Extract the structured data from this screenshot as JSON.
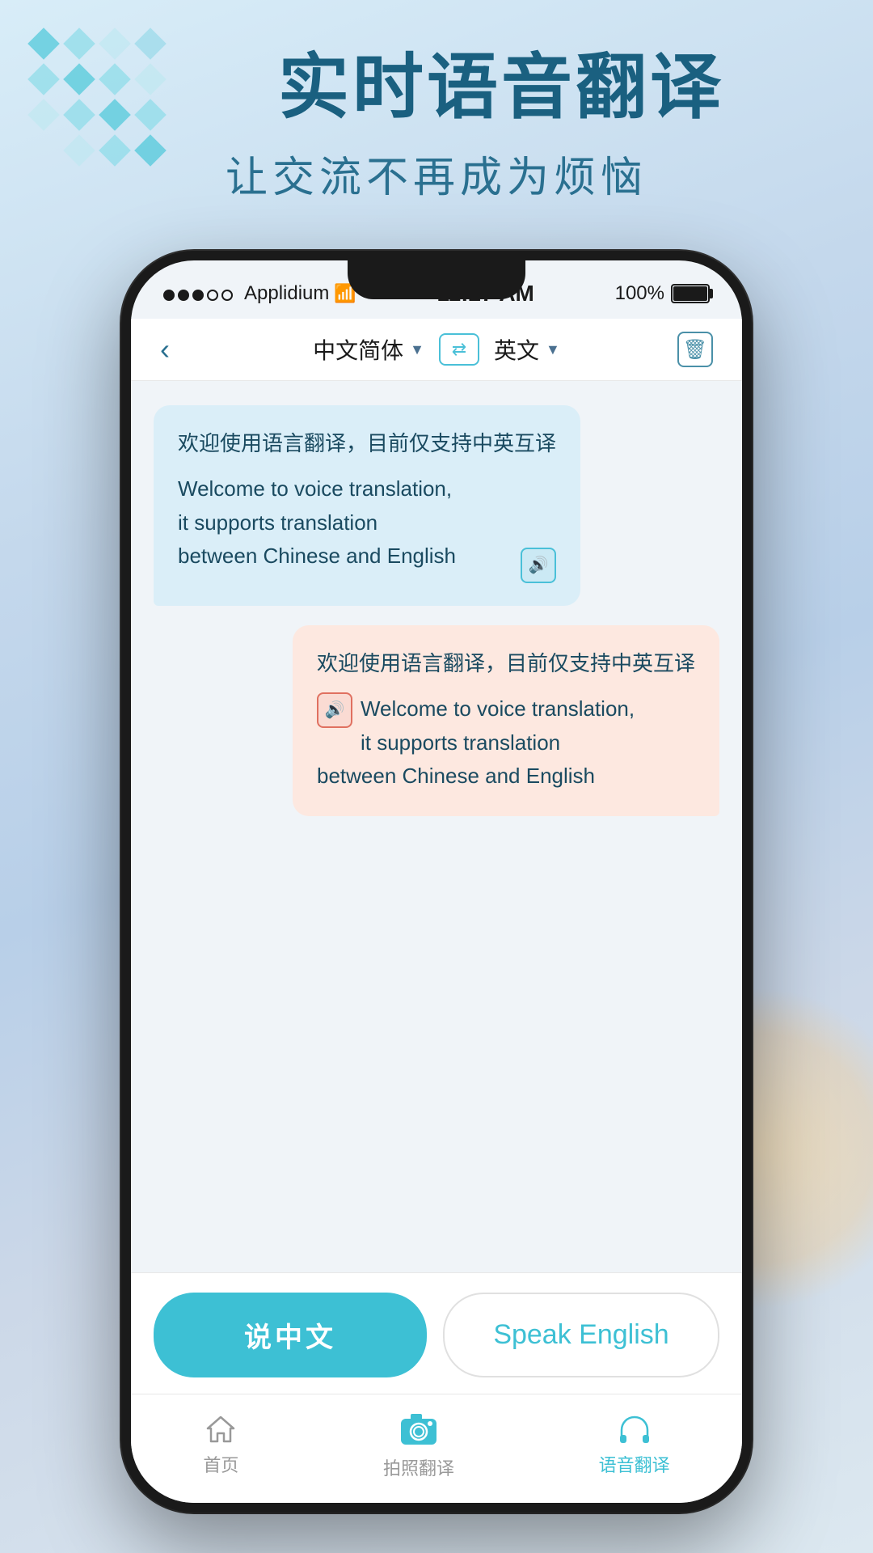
{
  "background": {
    "color_start": "#d8edf8",
    "color_end": "#c4d8ec"
  },
  "header": {
    "main_title": "实时语音翻译",
    "subtitle": "让交流不再成为烦恼"
  },
  "status_bar": {
    "carrier": "Applidium",
    "time": "11:27 AM",
    "battery": "100%"
  },
  "nav": {
    "back_label": "<",
    "lang_from": "中文简体",
    "lang_to": "英文",
    "trash_label": "🗑"
  },
  "messages": [
    {
      "direction": "left",
      "chinese": "欢迎使用语言翻译，目前仅支持中英互译",
      "english": "Welcome to voice translation, it supports translation between Chinese and English"
    },
    {
      "direction": "right",
      "chinese": "欢迎使用语言翻译，目前仅支持中英互译",
      "english": "Welcome to voice translation, it supports translation between Chinese and English"
    }
  ],
  "buttons": {
    "speak_chinese": "说中文",
    "speak_english": "Speak English"
  },
  "tabs": [
    {
      "label": "首页",
      "icon": "home",
      "active": false
    },
    {
      "label": "拍照翻译",
      "icon": "camera",
      "active": false
    },
    {
      "label": "语音翻译",
      "icon": "headphones",
      "active": true
    }
  ]
}
